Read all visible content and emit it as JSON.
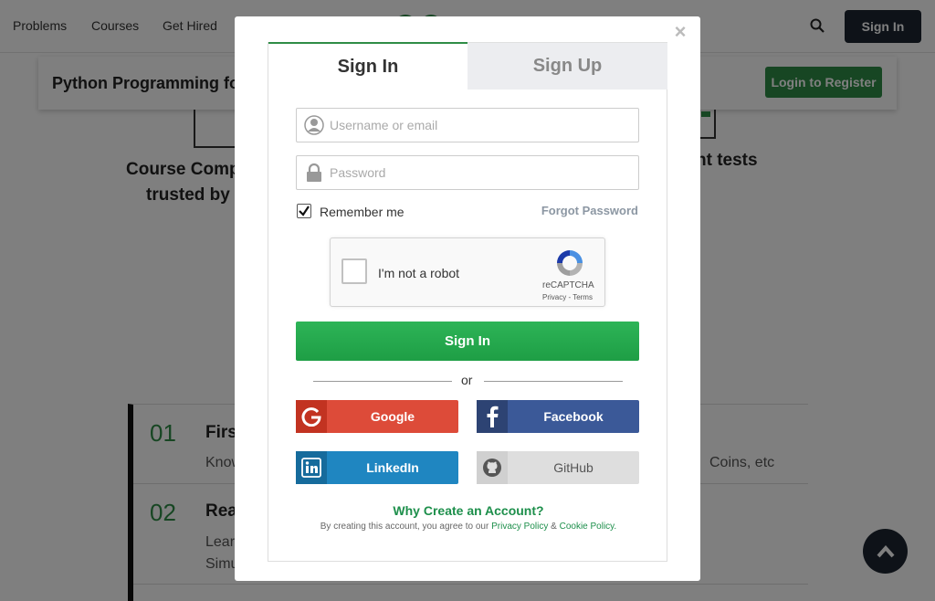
{
  "nav": {
    "links": [
      "Problems",
      "Courses",
      "Get Hired"
    ],
    "signin": "Sign In"
  },
  "course": {
    "title": "Python Programming fo",
    "login_register": "Login to Register"
  },
  "background": {
    "feature_line1": "Course Comp",
    "feature_line2": "trusted by",
    "feature_right": "nt tests",
    "topics": [
      {
        "num": "01",
        "title": "Firs",
        "desc": "Know",
        "right": "Coins, etc"
      },
      {
        "num": "02",
        "title": "Rea",
        "desc": "Lear",
        "desc2": "Simu"
      }
    ]
  },
  "modal": {
    "tabs": {
      "signin": "Sign In",
      "signup": "Sign Up"
    },
    "username_placeholder": "Username or email",
    "password_placeholder": "Password",
    "remember_label": "Remember me",
    "remember_checked": true,
    "forgot": "Forgot Password",
    "captcha": {
      "label": "I'm not a robot",
      "brand": "reCAPTCHA",
      "links": "Privacy - Terms"
    },
    "signin_button": "Sign In",
    "or": "or",
    "social": {
      "google": "Google",
      "facebook": "Facebook",
      "linkedin": "LinkedIn",
      "github": "GitHub"
    },
    "why": "Why Create an Account?",
    "terms_prefix": "By creating this account, you agree to our",
    "privacy_link": "Privacy Policy",
    "amp": "&",
    "cookie_link": "Cookie Policy."
  },
  "colors": {
    "brand_green": "#2f8d46",
    "signin_green": "#1e9e45",
    "google": "#dd4b39",
    "facebook": "#3b5998",
    "linkedin": "#1f86c1",
    "github": "#dedede",
    "dark": "#1c2530"
  },
  "icons": [
    "search-icon",
    "close-icon",
    "user-icon",
    "lock-icon",
    "checkmark-icon",
    "recaptcha-logo",
    "google-icon",
    "facebook-icon",
    "linkedin-icon",
    "github-icon",
    "chevron-up-icon"
  ]
}
